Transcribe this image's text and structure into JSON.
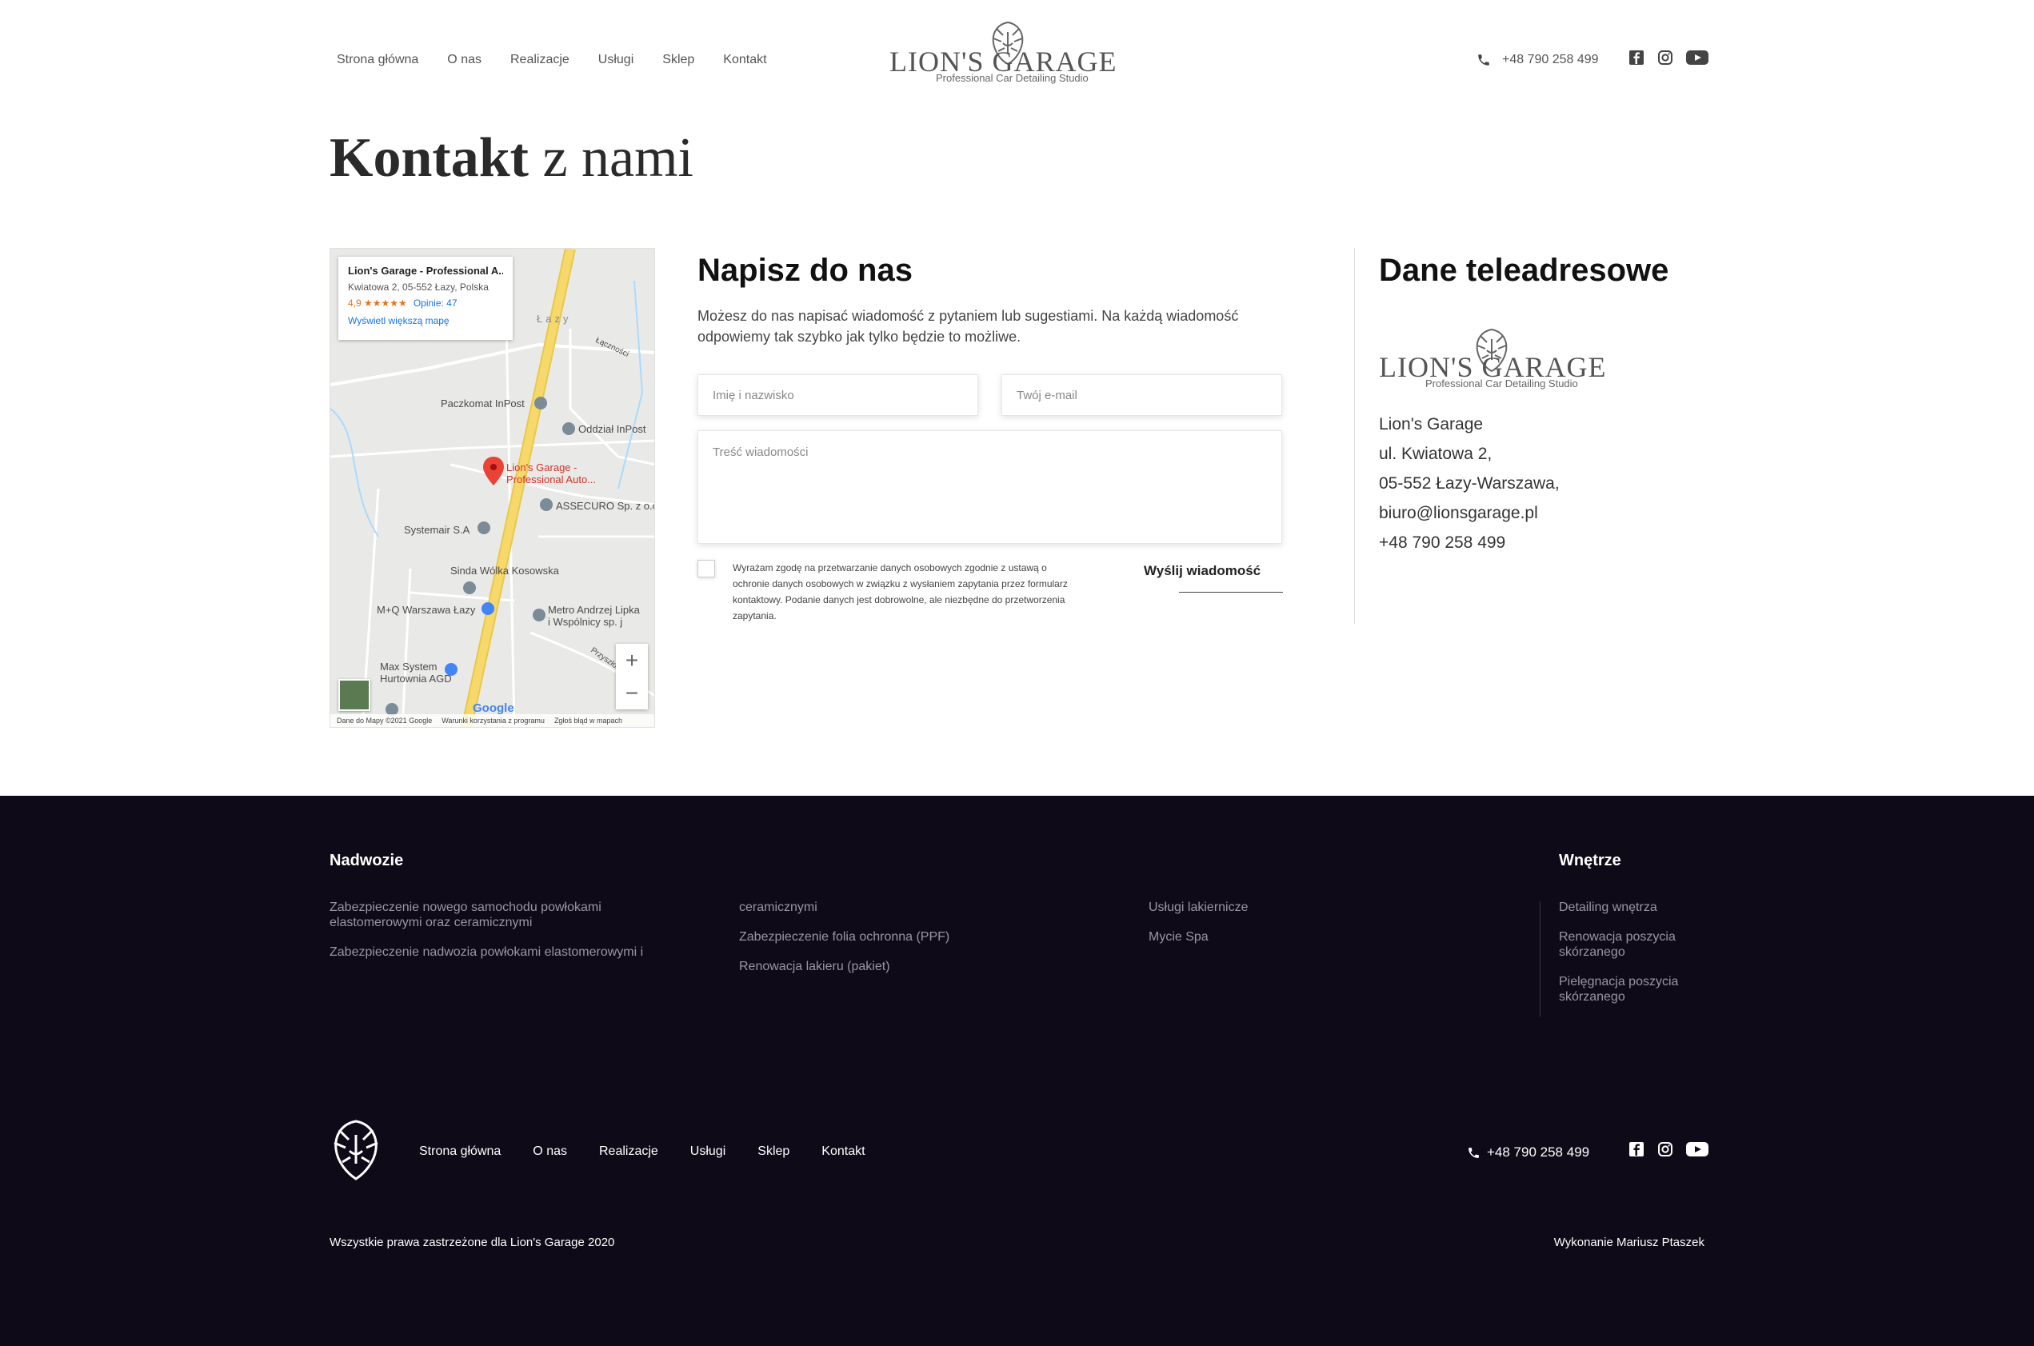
{
  "header": {
    "nav": [
      "Strona główna",
      "O nas",
      "Realizacje",
      "Usługi",
      "Sklep",
      "Kontakt"
    ],
    "logo_text": "LION'S GARAGE",
    "logo_sub": "Professional Car Detailing Studio",
    "phone": "+48 790 258 499"
  },
  "page": {
    "title_bold": "Kontakt",
    "title_light": "z nami"
  },
  "map": {
    "card_title": "Lion's Garage - Professional A...",
    "card_address": "Kwiatowa 2, 05-552 Łazy, Polska",
    "card_rating": "4,9 ★★★★★",
    "card_reviews": "Opinie: 47",
    "card_link": "Wyświetl większą mapę",
    "labels": {
      "lazy": "Łazy",
      "laczn": "Łączności",
      "paczkomat": "Paczkomat InPost",
      "oddzial": "Oddział InPost",
      "lions1": "Lion's Garage -",
      "lions2": "Professional Auto...",
      "assecuro": "ASSECURO Sp. z o.o.",
      "systemair": "Systemair S.A",
      "sinda": "Sinda Wólka Kosowska",
      "mq": "M+Q Warszawa Łazy",
      "metro1": "Metro Andrzej Lipka",
      "metro2": "i Wspólnicy sp. j",
      "max1": "Max System",
      "max2": "Hurtownia AGD",
      "przyszl": "Przyszłości"
    },
    "google": "Google",
    "footer_data": "Dane do Mapy ©2021 Google",
    "footer_terms": "Warunki korzystania z programu",
    "footer_report": "Zgłoś błąd w mapach"
  },
  "form": {
    "heading": "Napisz do nas",
    "description": "Możesz do nas napisać wiadomość z pytaniem lub sugestiami. Na każdą wiadomość odpowiemy tak szybko jak tylko będzie to możliwe.",
    "name_placeholder": "Imię i nazwisko",
    "email_placeholder": "Twój e-mail",
    "message_placeholder": "Treść wiadomości",
    "consent": "Wyrażam zgodę na przetwarzanie danych osobowych zgodnie z ustawą o ochronie danych osobowych w związku z wysłaniem zapytania przez formularz kontaktowy. Podanie danych jest dobrowolne, ale niezbędne do przetworzenia zapytania.",
    "submit": "Wyślij wiadomość"
  },
  "contact": {
    "heading": "Dane teleadresowe",
    "lines": [
      "Lion's Garage",
      "ul. Kwiatowa 2,",
      "05-552 Łazy-Warszawa,",
      "biuro@lionsgarage.pl",
      "+48 790 258 499"
    ]
  },
  "footer": {
    "col1_title": "Nadwozie",
    "col1_links": [
      "Zabezpieczenie nowego samochodu powłokami elastomerowymi oraz ceramicznymi",
      "Zabezpieczenie nadwozia powłokami elastomerowymi i"
    ],
    "col2_links": [
      "ceramicznymi",
      "Zabezpieczenie folia ochronna (PPF)",
      "Renowacja lakieru (pakiet)"
    ],
    "col3_links": [
      "Usługi lakiernicze",
      "Mycie Spa"
    ],
    "col4_title": "Wnętrze",
    "col4_links": [
      "Detailing wnętrza",
      "Renowacja poszycia skórzanego",
      "Pielęgnacja poszycia skórzanego"
    ],
    "nav": [
      "Strona główna",
      "O nas",
      "Realizacje",
      "Usługi",
      "Sklep",
      "Kontakt"
    ],
    "phone": "+48 790 258 499",
    "copyright": "Wszystkie prawa zastrzeżone dla Lion's Garage 2020",
    "credit": "Wykonanie Mariusz Ptaszek"
  },
  "colors": {
    "footer_bg": "#0e0a17",
    "map_road": "#f6d96a",
    "map_pin": "#ea4335"
  }
}
